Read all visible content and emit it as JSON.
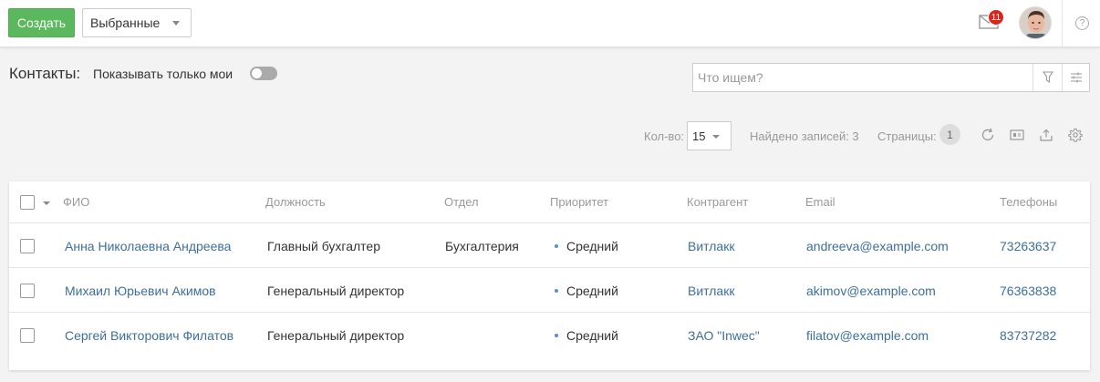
{
  "topbar": {
    "create_label": "Создать",
    "favorites_label": "Выбранные",
    "mail_badge": "11",
    "help_glyph": "?"
  },
  "header": {
    "title": "Контакты:",
    "only_mine_label": "Показывать только мои",
    "only_mine_on": false
  },
  "search": {
    "placeholder": "Что ищем?",
    "value": ""
  },
  "pagination": {
    "count_label": "Кол-во:",
    "count_value": "15",
    "found_label": "Найдено записей: 3",
    "pages_label": "Страницы:",
    "current_page": "1"
  },
  "table": {
    "columns": {
      "name": "ФИО",
      "position": "Должность",
      "department": "Отдел",
      "priority": "Приоритет",
      "contractor": "Контрагент",
      "email": "Email",
      "phones": "Телефоны"
    },
    "rows": [
      {
        "name": "Анна Николаевна Андреева",
        "position": "Главный бухгалтер",
        "department": "Бухгалтерия",
        "priority": "Средний",
        "contractor": "Витлакк",
        "email": "andreeva@example.com",
        "phone": "73263637"
      },
      {
        "name": "Михаил Юрьевич Акимов",
        "position": "Генеральный директор",
        "department": "",
        "priority": "Средний",
        "contractor": "Витлакк",
        "email": "akimov@example.com",
        "phone": "76363838"
      },
      {
        "name": "Сергей Викторович Филатов",
        "position": "Генеральный директор",
        "department": "",
        "priority": "Средний",
        "contractor": "ЗАО \"Inwec\"",
        "email": "filatov@example.com",
        "phone": "83737282"
      }
    ]
  },
  "colors": {
    "create_button": "#5cb85c",
    "link": "#3d6f9c",
    "badge": "#d9251c",
    "priority_dot": "#5b8fc7"
  },
  "icons": [
    "mail-icon",
    "avatar",
    "help-icon",
    "filter-icon",
    "sliders-icon",
    "refresh-icon",
    "card-icon",
    "export-icon",
    "gear-icon"
  ]
}
